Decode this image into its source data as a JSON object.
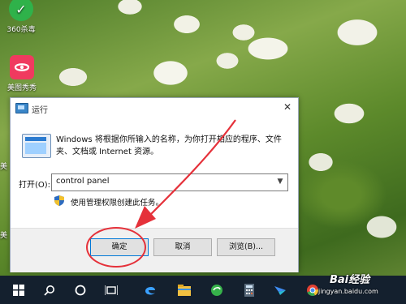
{
  "desktop": {
    "icons": [
      {
        "label": "360杀毒",
        "icon": "360-antivirus-icon"
      },
      {
        "label": "美图秀秀",
        "icon": "meitu-icon"
      }
    ],
    "side_labels": [
      "美",
      "美"
    ]
  },
  "dialog": {
    "title": "运行",
    "close_glyph": "✕",
    "description": "Windows 将根据你所输入的名称，为你打开相应的程序、文件夹、文档或 Internet 资源。",
    "open_label": "打开(O):",
    "input_value": "control panel",
    "admin_note": "使用管理权限创建此任务。",
    "buttons": {
      "ok": "确定",
      "cancel": "取消",
      "browse": "浏览(B)..."
    }
  },
  "taskbar": {
    "items": [
      "start-icon",
      "search-icon",
      "cortana-icon",
      "task-view-icon",
      "edge-icon",
      "file-explorer-icon",
      "browser-360-icon",
      "calculator-icon",
      "feishu-icon",
      "chrome-icon"
    ]
  },
  "watermark": {
    "main": "Bai经验",
    "sub": "jingyan.baidu.com"
  },
  "colors": {
    "annotation": "#e5313a",
    "taskbar": "#14202e",
    "accent": "#0078d7"
  }
}
